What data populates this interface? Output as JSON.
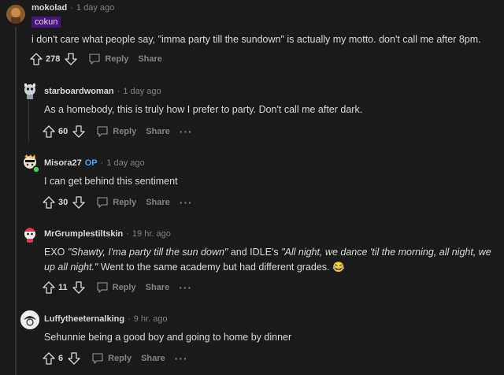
{
  "comments": [
    {
      "author": "mokolad",
      "time": "1 day ago",
      "flair": "cokun",
      "text": "i don't care what people say, \"imma party till the sundown\" is actually my motto. don't call me after 8pm.",
      "votes": "278",
      "reply_label": "Reply",
      "share_label": "Share"
    },
    {
      "author": "starboardwoman",
      "time": "1 day ago",
      "text": "As a homebody, this is truly how I prefer to party. Don't call me after dark.",
      "votes": "60",
      "reply_label": "Reply",
      "share_label": "Share",
      "more_label": "···"
    },
    {
      "author": "Misora27",
      "op_label": "OP",
      "time": "1 day ago",
      "text": "I can get behind this sentiment",
      "votes": "30",
      "reply_label": "Reply",
      "share_label": "Share",
      "more_label": "···"
    },
    {
      "author": "MrGrumplestiltskin",
      "time": "19 hr. ago",
      "text_parts": {
        "a": "EXO ",
        "b": "\"Shawty, I'ma party till the sun down\"",
        "c": " and IDLE's ",
        "d": "\"All night, we dance 'til the morning, all night, we up all night.\"",
        "e": " Went to the same academy but had different grades. ",
        "emoji": "😂"
      },
      "votes": "11",
      "reply_label": "Reply",
      "share_label": "Share",
      "more_label": "···"
    },
    {
      "author": "Luffytheeternalking",
      "time": "9 hr. ago",
      "text": "Sehunnie being a good boy and going to home by dinner",
      "votes": "6",
      "reply_label": "Reply",
      "share_label": "Share",
      "more_label": "···"
    }
  ],
  "separator": "·",
  "icons": [
    "upvote-icon",
    "downvote-icon",
    "reply-icon",
    "more-icon"
  ],
  "colors": {
    "background": "#1a1a1b",
    "text": "#d7dadc",
    "muted": "#818384",
    "flair_bg": "#46147a",
    "op": "#3ea6ff"
  }
}
